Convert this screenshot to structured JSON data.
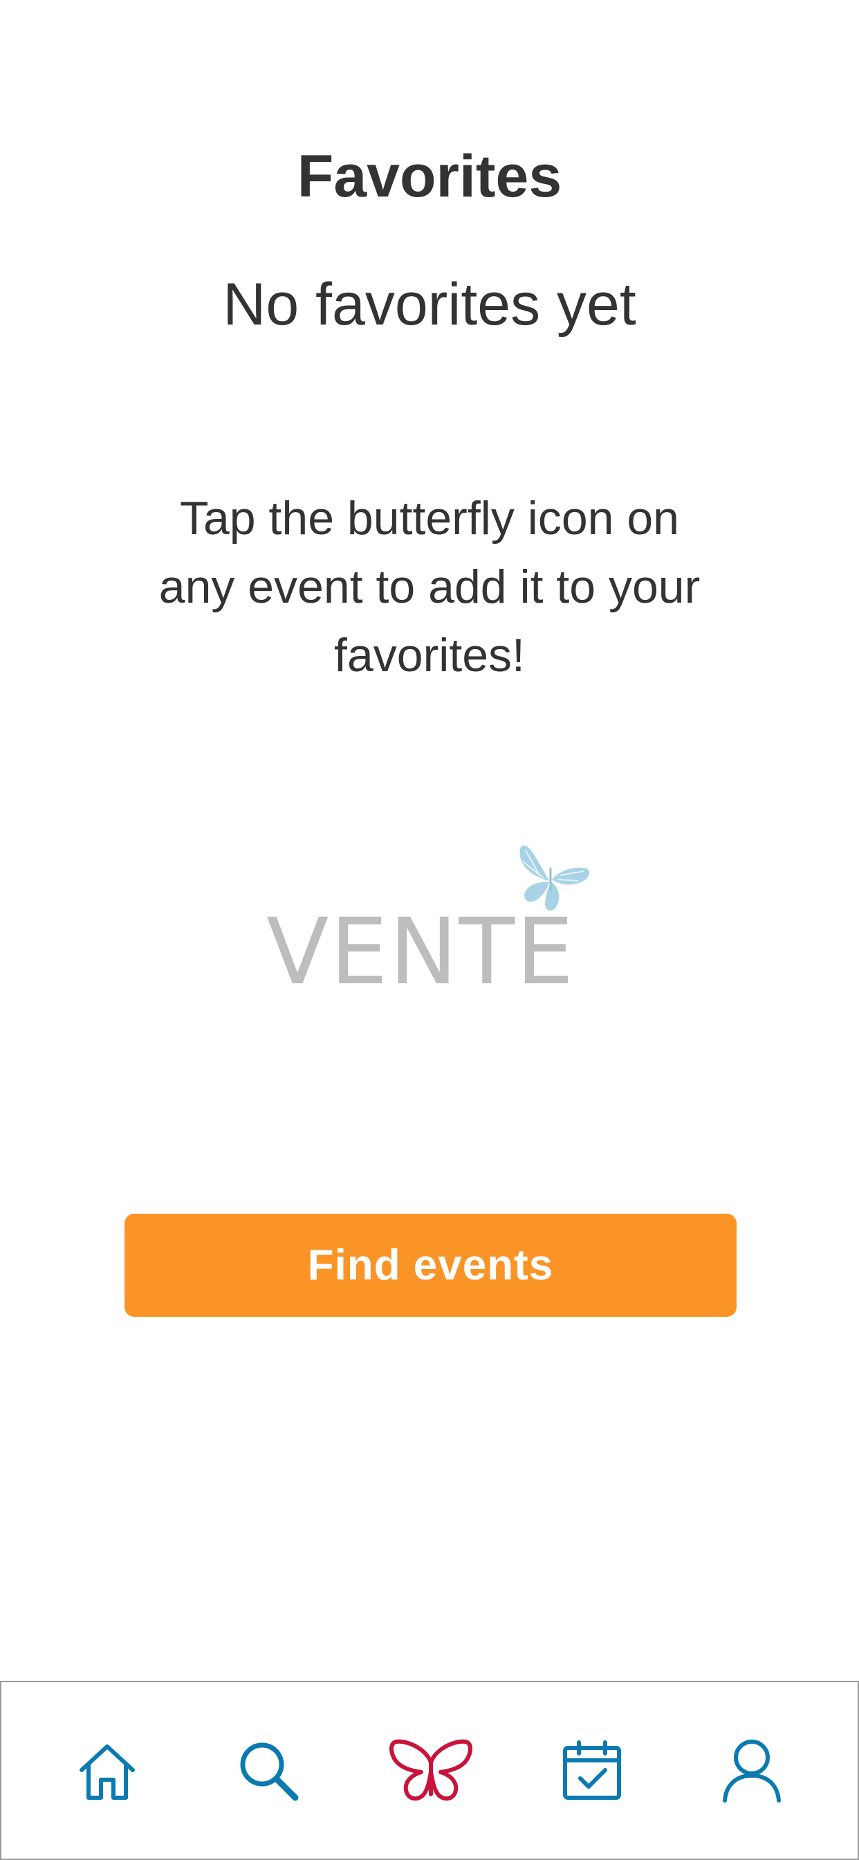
{
  "header": {
    "title": "Favorites"
  },
  "empty_state": {
    "heading": "No favorites yet",
    "message": "Tap the butterfly icon on any event to add it to your favorites!",
    "logo": {
      "text": "VENTE",
      "icon": "butterfly-icon"
    }
  },
  "actions": {
    "find_events_label": "Find events"
  },
  "tab_bar": {
    "items": [
      {
        "name": "home",
        "icon": "home-icon",
        "active": false
      },
      {
        "name": "search",
        "icon": "search-icon",
        "active": false
      },
      {
        "name": "favorites",
        "icon": "butterfly-icon",
        "active": true
      },
      {
        "name": "calendar",
        "icon": "calendar-check-icon",
        "active": false
      },
      {
        "name": "profile",
        "icon": "user-icon",
        "active": false
      }
    ]
  },
  "colors": {
    "accent_orange": "#fb9426",
    "icon_blue": "#0b7ab0",
    "active_red": "#c8143c",
    "logo_gray": "#bdbdbd",
    "logo_butterfly": "#a8d3e6",
    "text_dark": "#333333"
  }
}
